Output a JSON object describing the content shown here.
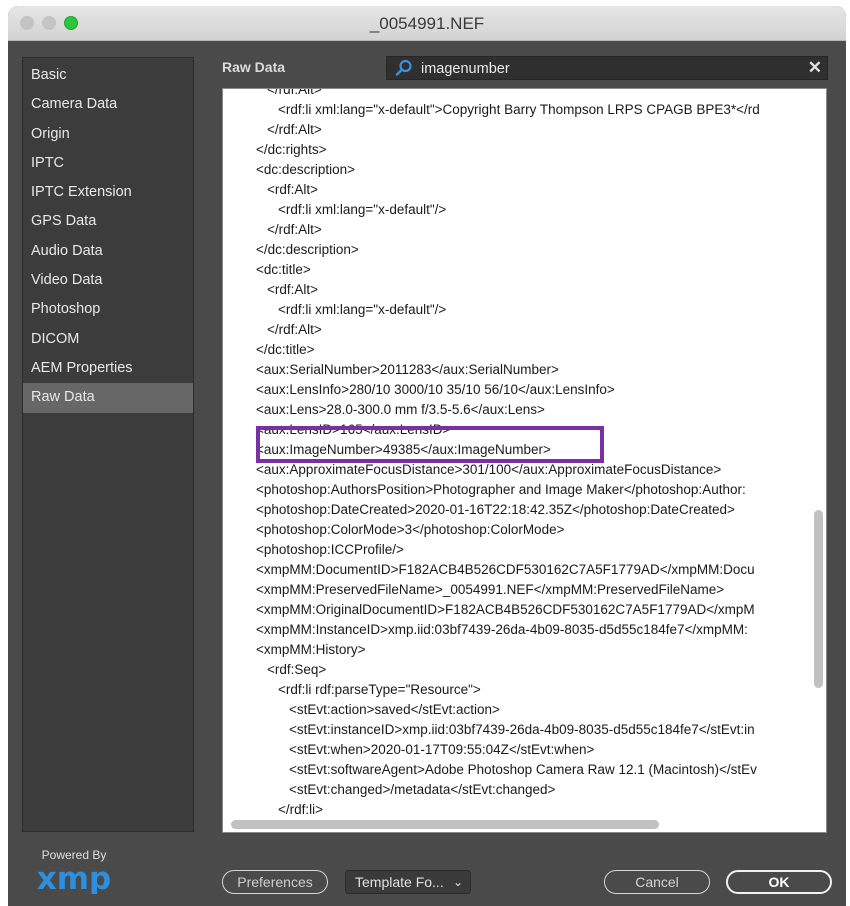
{
  "window": {
    "title": "_0054991.NEF"
  },
  "sidebar": {
    "items": [
      {
        "label": "Basic"
      },
      {
        "label": "Camera Data"
      },
      {
        "label": "Origin"
      },
      {
        "label": "IPTC"
      },
      {
        "label": "IPTC Extension"
      },
      {
        "label": "GPS Data"
      },
      {
        "label": "Audio Data"
      },
      {
        "label": "Video Data"
      },
      {
        "label": "Photoshop"
      },
      {
        "label": "DICOM"
      },
      {
        "label": "AEM Properties"
      },
      {
        "label": "Raw Data"
      }
    ],
    "active_index": 11
  },
  "panel": {
    "label": "Raw Data"
  },
  "search": {
    "value": "imagenumber"
  },
  "raw_lines": [
    {
      "indent": 2,
      "text": "</rdf:Alt>"
    },
    {
      "indent": 3,
      "text": "<rdf:li xml:lang=\"x-default\">Copyright Barry Thompson LRPS CPAGB BPE3*</rd"
    },
    {
      "indent": 2,
      "text": "</rdf:Alt>"
    },
    {
      "indent": 1,
      "text": "</dc:rights>"
    },
    {
      "indent": 1,
      "text": "<dc:description>"
    },
    {
      "indent": 2,
      "text": "<rdf:Alt>"
    },
    {
      "indent": 3,
      "text": "<rdf:li xml:lang=\"x-default\"/>"
    },
    {
      "indent": 2,
      "text": "</rdf:Alt>"
    },
    {
      "indent": 1,
      "text": "</dc:description>"
    },
    {
      "indent": 1,
      "text": "<dc:title>"
    },
    {
      "indent": 2,
      "text": "<rdf:Alt>"
    },
    {
      "indent": 3,
      "text": "<rdf:li xml:lang=\"x-default\"/>"
    },
    {
      "indent": 2,
      "text": "</rdf:Alt>"
    },
    {
      "indent": 1,
      "text": "</dc:title>"
    },
    {
      "indent": 1,
      "text": "<aux:SerialNumber>2011283</aux:SerialNumber>"
    },
    {
      "indent": 1,
      "text": "<aux:LensInfo>280/10 3000/10 35/10 56/10</aux:LensInfo>"
    },
    {
      "indent": 1,
      "text": "<aux:Lens>28.0-300.0 mm f/3.5-5.6</aux:Lens>"
    },
    {
      "indent": 1,
      "text": "<aux:LensID>165</aux:LensID>"
    },
    {
      "indent": 1,
      "text": "<aux:ImageNumber>49385</aux:ImageNumber>"
    },
    {
      "indent": 1,
      "text": "<aux:ApproximateFocusDistance>301/100</aux:ApproximateFocusDistance>"
    },
    {
      "indent": 1,
      "text": "<photoshop:AuthorsPosition>Photographer and Image Maker</photoshop:Author:"
    },
    {
      "indent": 1,
      "text": "<photoshop:DateCreated>2020-01-16T22:18:42.35Z</photoshop:DateCreated>"
    },
    {
      "indent": 1,
      "text": "<photoshop:ColorMode>3</photoshop:ColorMode>"
    },
    {
      "indent": 1,
      "text": "<photoshop:ICCProfile/>"
    },
    {
      "indent": 1,
      "text": "<xmpMM:DocumentID>F182ACB4B526CDF530162C7A5F1779AD</xmpMM:Docu"
    },
    {
      "indent": 1,
      "text": "<xmpMM:PreservedFileName>_0054991.NEF</xmpMM:PreservedFileName>"
    },
    {
      "indent": 1,
      "text": "<xmpMM:OriginalDocumentID>F182ACB4B526CDF530162C7A5F1779AD</xmpM"
    },
    {
      "indent": 1,
      "text": "<xmpMM:InstanceID>xmp.iid:03bf7439-26da-4b09-8035-d5d55c184fe7</xmpMM:"
    },
    {
      "indent": 1,
      "text": "<xmpMM:History>"
    },
    {
      "indent": 2,
      "text": "<rdf:Seq>"
    },
    {
      "indent": 3,
      "text": "<rdf:li rdf:parseType=\"Resource\">"
    },
    {
      "indent": 4,
      "text": "<stEvt:action>saved</stEvt:action>"
    },
    {
      "indent": 4,
      "text": "<stEvt:instanceID>xmp.iid:03bf7439-26da-4b09-8035-d5d55c184fe7</stEvt:in"
    },
    {
      "indent": 4,
      "text": "<stEvt:when>2020-01-17T09:55:04Z</stEvt:when>"
    },
    {
      "indent": 4,
      "text": "<stEvt:softwareAgent>Adobe Photoshop Camera Raw 12.1 (Macintosh)</stEv"
    },
    {
      "indent": 4,
      "text": "<stEvt:changed>/metadata</stEvt:changed>"
    },
    {
      "indent": 3,
      "text": "</rdf:li>"
    }
  ],
  "footer": {
    "powered_by": "Powered By",
    "logo_text": "xmp",
    "preferences_label": "Preferences",
    "template_label": "Template Fo...",
    "cancel_label": "Cancel",
    "ok_label": "OK"
  },
  "colors": {
    "highlight": "#7a2fa3",
    "xmp_logo": "#2c8fe0",
    "search_icon": "#3d8ee0"
  }
}
